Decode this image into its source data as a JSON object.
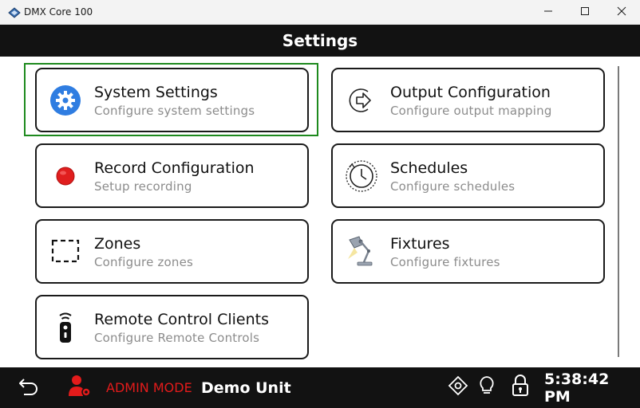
{
  "window": {
    "title": "DMX Core 100",
    "icons": {
      "app": "dmx-diamond-icon",
      "minimize": "minimize-icon",
      "maximize": "maximize-icon",
      "close": "close-icon"
    }
  },
  "header": {
    "title": "Settings"
  },
  "tiles": [
    {
      "title": "System Settings",
      "subtitle": "Configure system settings",
      "icon": "gear-icon",
      "selected": true
    },
    {
      "title": "Output Configuration",
      "subtitle": "Configure output mapping",
      "icon": "output-arrow-icon"
    },
    {
      "title": "Record Configuration",
      "subtitle": "Setup recording",
      "icon": "record-icon"
    },
    {
      "title": "Schedules",
      "subtitle": "Configure schedules",
      "icon": "schedule-clock-icon"
    },
    {
      "title": "Zones",
      "subtitle": "Configure zones",
      "icon": "zones-dashed-square-icon"
    },
    {
      "title": "Fixtures",
      "subtitle": "Configure fixtures",
      "icon": "lamp-fixture-icon"
    },
    {
      "title": "Remote Control Clients",
      "subtitle": "Configure Remote Controls",
      "icon": "remote-control-icon"
    }
  ],
  "bottom_bar": {
    "admin_mode": "ADMIN MODE",
    "unit_name": "Demo Unit",
    "time": "5:38:42 PM",
    "icons": {
      "back": "back-arrow-icon",
      "admin": "admin-user-gear-icon",
      "position": "position-target-icon",
      "light": "lightbulb-icon",
      "lock": "lock-icon"
    }
  },
  "colors": {
    "header_bg": "#121212",
    "admin_red": "#e31b1b",
    "focus_green": "#1e8a1e",
    "gear_blue": "#2f7de1",
    "record_red": "#e01e1e"
  }
}
